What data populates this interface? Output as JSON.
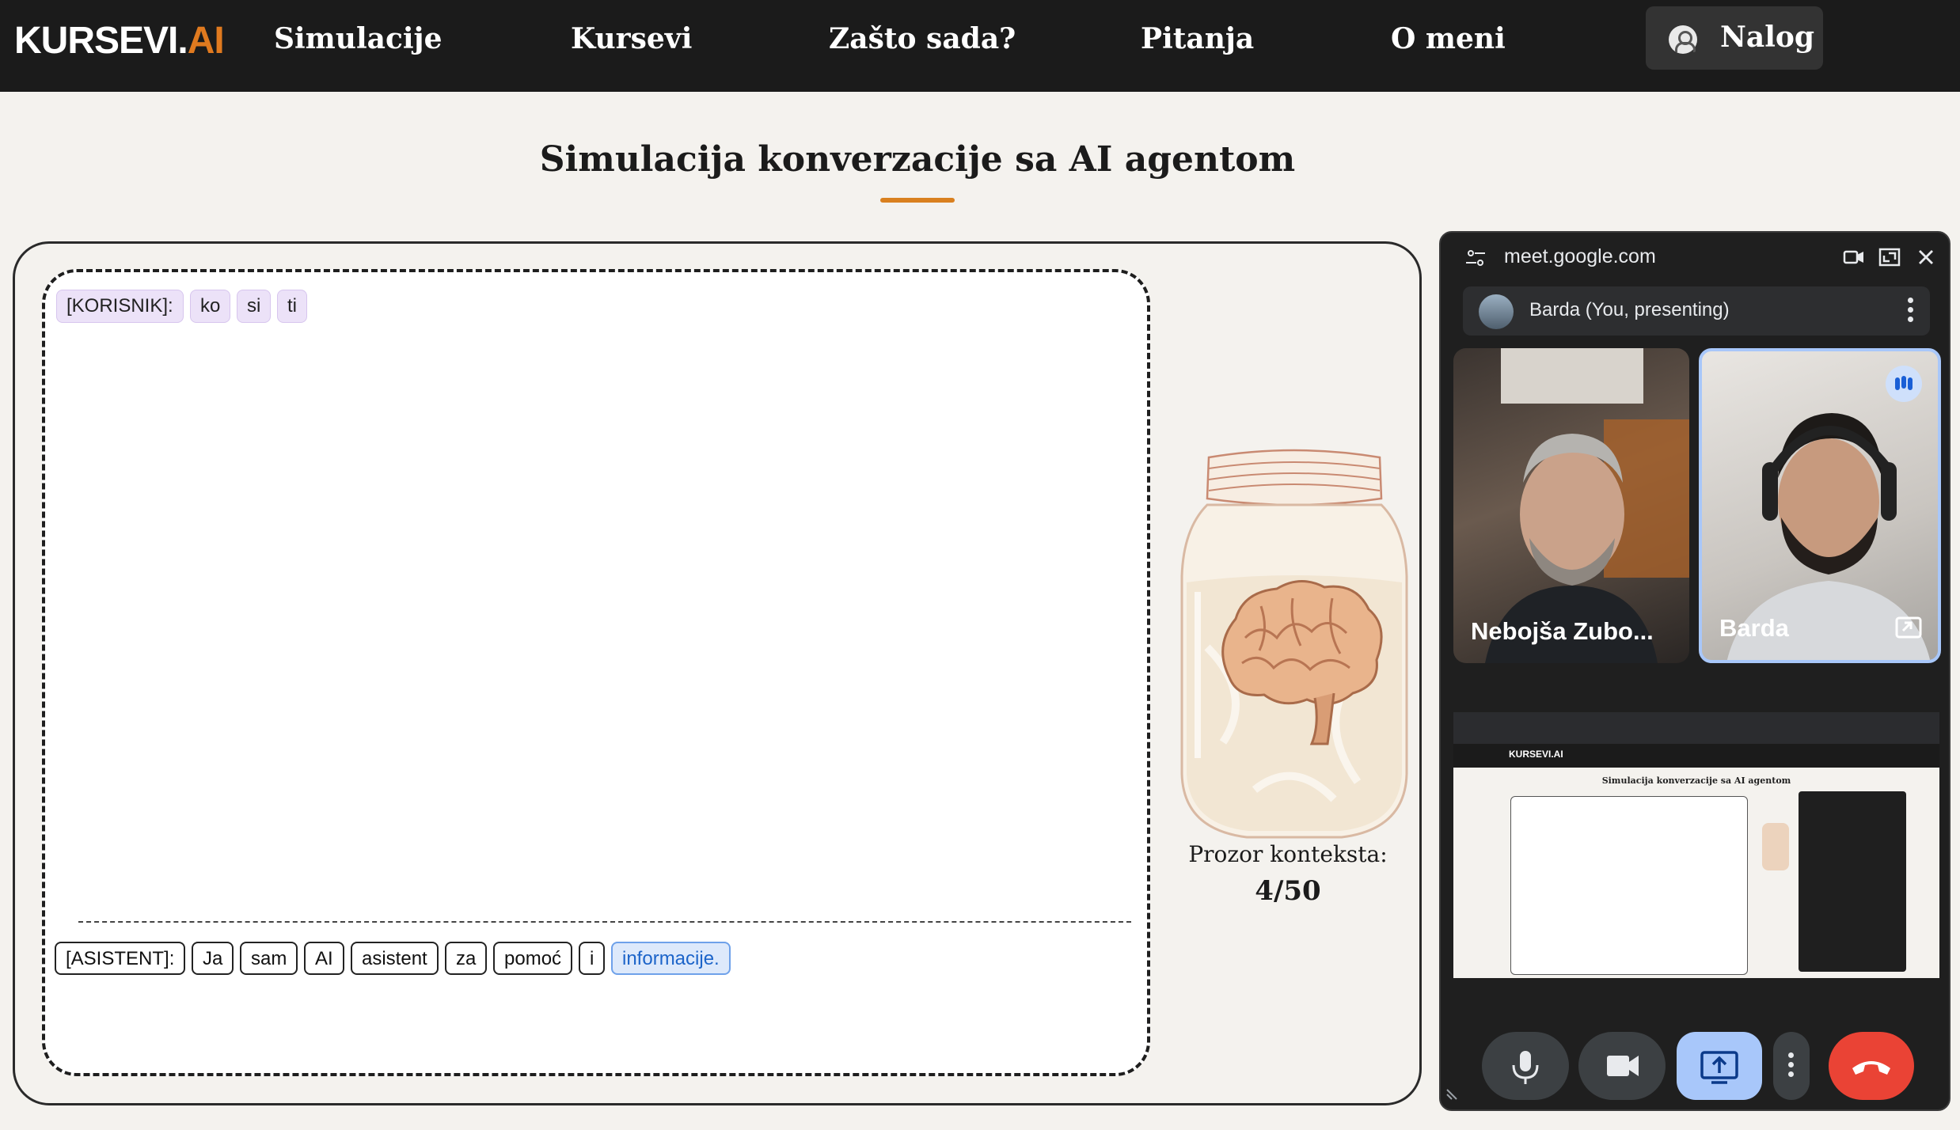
{
  "nav": {
    "logo_main": "KURSEVI.",
    "logo_accent": "AI",
    "links": [
      "Simulacije",
      "Kursevi",
      "Zašto sada?",
      "Pitanja",
      "O meni"
    ],
    "account_label": "Nalog"
  },
  "page": {
    "title": "Simulacija konverzacije sa AI agentom"
  },
  "chat": {
    "user_tokens": [
      "[KORISNIK]:",
      "ko",
      "si",
      "ti"
    ],
    "assistant_tokens": [
      "[ASISTENT]:",
      "Ja",
      "sam",
      "AI",
      "asistent",
      "za",
      "pomoć",
      "i",
      "informacije."
    ],
    "highlighted_token_index": 8
  },
  "context": {
    "label": "Prozor konteksta:",
    "value": "4/50"
  },
  "meet": {
    "url": "meet.google.com",
    "presenter_label": "Barda (You, presenting)",
    "participants": [
      {
        "name": "Nebojša Zubo...",
        "speaking": false
      },
      {
        "name": "Barda",
        "speaking": true
      }
    ],
    "preview": {
      "logo": "KURSEVI.AI",
      "title": "Simulacija konverzacije sa AI agentom"
    }
  },
  "colors": {
    "nav_bg": "#1b1b1b",
    "accent": "#e07a1f",
    "page_bg": "#f4f2ee",
    "user_token_bg": "#ece2f8",
    "highlight_token_bg": "#dde9fb",
    "end_call": "#ea4335",
    "share_active": "#a8c7fa"
  },
  "icons": {
    "account": "person-icon",
    "jar": "brain-jar-illustration",
    "meet_controls": [
      "mic-icon",
      "camera-icon",
      "present-screen-icon",
      "more-vert-icon",
      "end-call-icon"
    ]
  }
}
